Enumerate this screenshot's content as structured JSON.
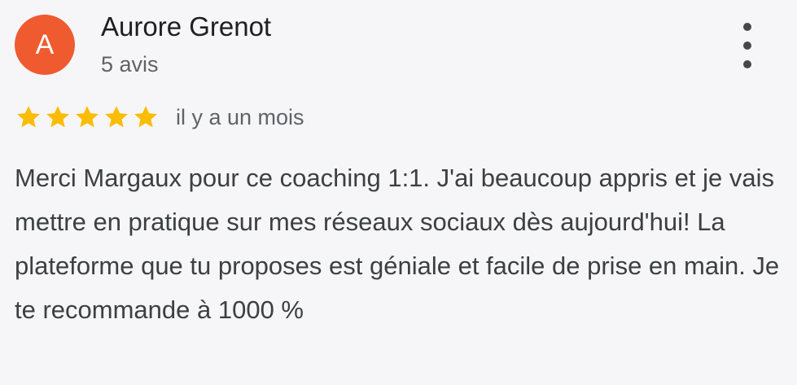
{
  "reviewer": {
    "avatar_letter": "A",
    "avatar_color": "#ef5b2f",
    "name": "Aurore Grenot",
    "review_count": "5 avis"
  },
  "menu": {
    "icon": "more-vert-icon"
  },
  "rating": {
    "stars": 5,
    "max_stars": 5,
    "star_color": "#fbbc04",
    "date": "il y a un mois"
  },
  "review": {
    "text": "Merci Margaux pour ce coaching 1:1. J'ai beaucoup appris et je vais mettre en pratique sur mes réseaux sociaux dès aujourd'hui! La plateforme que tu proposes est géniale et facile de prise en main. Je te recommande à 1000 %"
  }
}
